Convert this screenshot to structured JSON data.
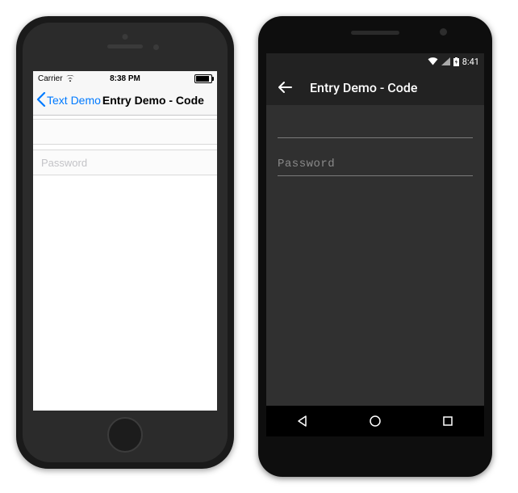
{
  "ios": {
    "status": {
      "carrier": "Carrier",
      "time": "8:38 PM"
    },
    "nav": {
      "back_label": "Text Demo",
      "title": "Entry Demo - Code"
    },
    "fields": {
      "entry1": {
        "value": "",
        "placeholder": ""
      },
      "password": {
        "value": "",
        "placeholder": "Password"
      }
    }
  },
  "android": {
    "status": {
      "time": "8:41"
    },
    "appbar": {
      "title": "Entry Demo - Code"
    },
    "fields": {
      "entry1": {
        "value": "",
        "placeholder": ""
      },
      "password": {
        "value": "",
        "placeholder": "Password"
      }
    }
  }
}
